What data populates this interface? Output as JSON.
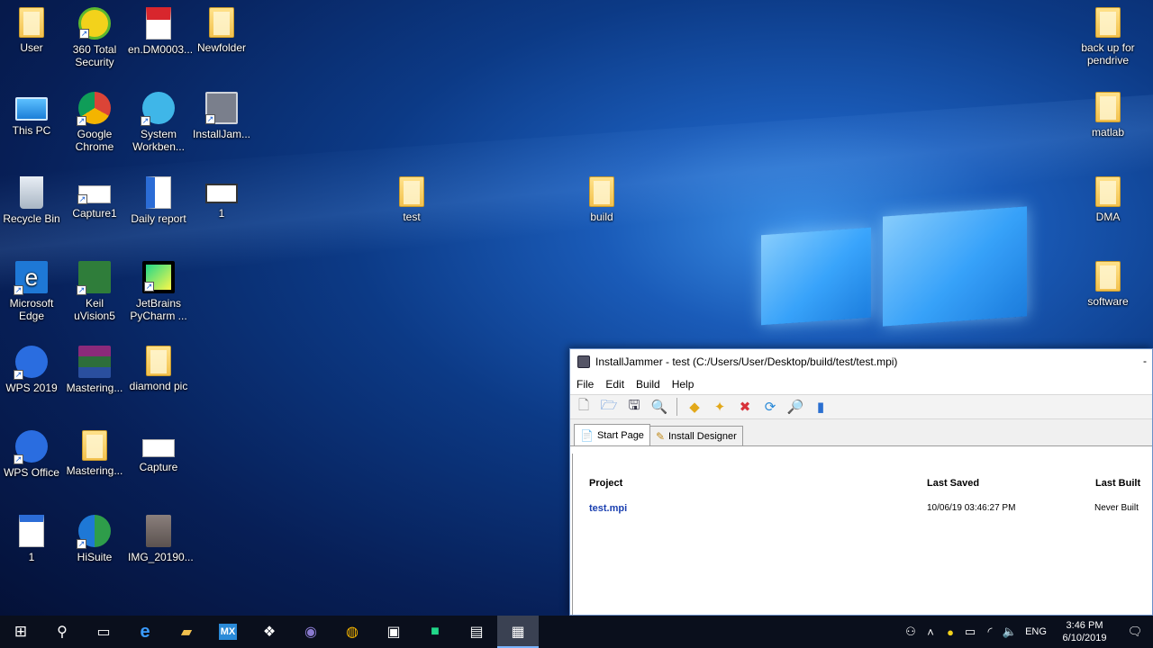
{
  "desktop": {
    "icons": [
      {
        "label": "User",
        "icon": "user-folder-icon"
      },
      {
        "label": "360 Total Security",
        "icon": "360-security-icon"
      },
      {
        "label": "en.DM0003...",
        "icon": "pdf-icon"
      },
      {
        "label": "Newfolder",
        "icon": "folder-icon"
      },
      {
        "label": "This PC",
        "icon": "computer-icon"
      },
      {
        "label": "Google Chrome",
        "icon": "chrome-icon"
      },
      {
        "label": "System Workben...",
        "icon": "system-workbench-icon"
      },
      {
        "label": "InstallJam...",
        "icon": "installjammer-icon"
      },
      {
        "label": "Recycle Bin",
        "icon": "recycle-bin-icon"
      },
      {
        "label": "Capture1",
        "icon": "image-icon"
      },
      {
        "label": "Daily report",
        "icon": "word-doc-icon"
      },
      {
        "label": "1",
        "icon": "image-icon"
      },
      {
        "label": "Microsoft Edge",
        "icon": "edge-icon"
      },
      {
        "label": "Keil uVision5",
        "icon": "keil-icon"
      },
      {
        "label": "JetBrains PyCharm ...",
        "icon": "pycharm-icon"
      },
      {
        "label": "WPS 2019",
        "icon": "wps-icon"
      },
      {
        "label": "Mastering...",
        "icon": "winrar-icon"
      },
      {
        "label": "diamond pic",
        "icon": "folder-icon"
      },
      {
        "label": "WPS Office",
        "icon": "wps-icon"
      },
      {
        "label": "Mastering...",
        "icon": "folder-icon"
      },
      {
        "label": "Capture",
        "icon": "image-icon"
      },
      {
        "label": "1",
        "icon": "word-doc-icon"
      },
      {
        "label": "HiSuite",
        "icon": "hisuite-icon"
      },
      {
        "label": "IMG_20190...",
        "icon": "photo-icon"
      },
      {
        "label": "test",
        "icon": "folder-icon"
      },
      {
        "label": "build",
        "icon": "folder-icon"
      },
      {
        "label": "back up for pendrive",
        "icon": "folder-icon"
      },
      {
        "label": "matlab",
        "icon": "folder-icon"
      },
      {
        "label": "DMA",
        "icon": "folder-icon"
      },
      {
        "label": "software",
        "icon": "folder-icon"
      }
    ]
  },
  "window": {
    "title": "InstallJammer - test (C:/Users/User/Desktop/build/test/test.mpi)",
    "minimize": "-",
    "menu": [
      "File",
      "Edit",
      "Build",
      "Help"
    ],
    "tabs": [
      {
        "label": "Start Page",
        "icon": "start-page-icon"
      },
      {
        "label": "Install Designer",
        "icon": "wand-icon"
      }
    ],
    "table": {
      "headers": {
        "project": "Project",
        "saved": "Last Saved",
        "built": "Last Built"
      },
      "rows": [
        {
          "project": "test.mpi",
          "saved": "10/06/19 03:46:27 PM",
          "built": "Never Built"
        }
      ]
    }
  },
  "taskbar": {
    "items": [
      "start-icon",
      "search-icon",
      "task-view-icon",
      "edge-icon",
      "file-explorer-icon",
      "mx-icon",
      "dropbox-icon",
      "eclipse-icon",
      "chrome-icon",
      "photos-icon",
      "pycharm-icon",
      "terminal-icon",
      "installjammer-icon"
    ],
    "language": "ENG",
    "time": "3:46 PM",
    "date": "6/10/2019"
  }
}
